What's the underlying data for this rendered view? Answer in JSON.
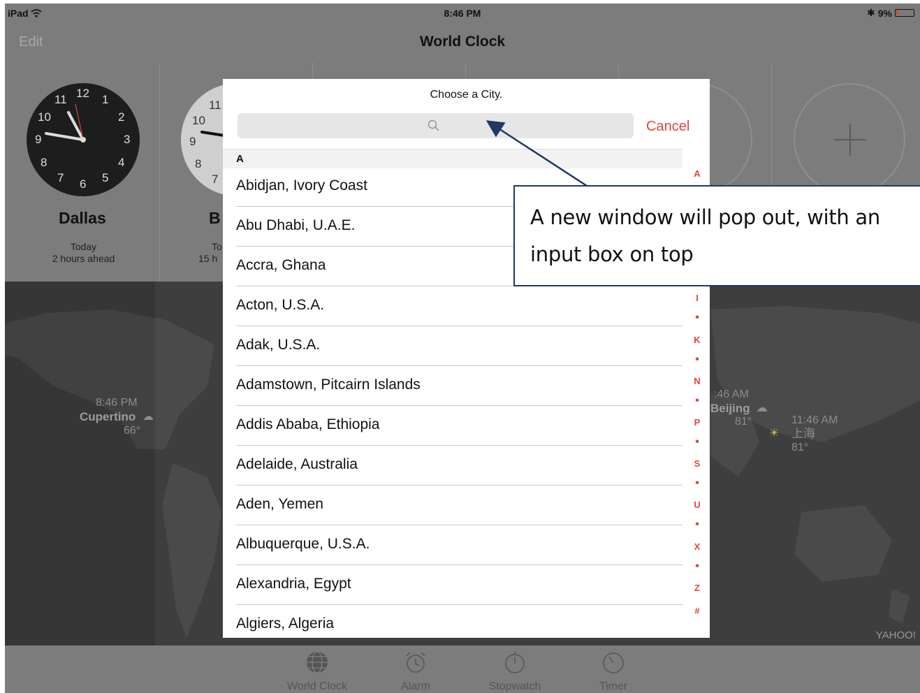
{
  "status_bar": {
    "device": "iPad",
    "time": "8:46 PM",
    "battery": "9%"
  },
  "nav": {
    "edit": "Edit",
    "title": "World Clock"
  },
  "clocks": [
    {
      "name": "Dallas",
      "day": "Today",
      "offset": "2 hours ahead"
    },
    {
      "name": "B",
      "day": "To",
      "offset": "15 h"
    }
  ],
  "clock_numbers": [
    "12",
    "1",
    "2",
    "3",
    "4",
    "5",
    "6",
    "7",
    "8",
    "9",
    "10",
    "11"
  ],
  "map": {
    "cupertino": {
      "time": "8:46 PM",
      "name": "Cupertino",
      "temp": "66°"
    },
    "beijing": {
      "time": ":46 AM",
      "name": "Beijing",
      "temp": "81°"
    },
    "shanghai": {
      "time": "11:46 AM",
      "name": "上海",
      "temp": "81°"
    },
    "credit": "YAHOO!"
  },
  "popover": {
    "title": "Choose a City.",
    "search_placeholder": "",
    "cancel": "Cancel",
    "section": "A",
    "cities": [
      "Abidjan, Ivory Coast",
      "Abu Dhabi, U.A.E.",
      "Accra, Ghana",
      "Acton, U.S.A.",
      "Adak, U.S.A.",
      "Adamstown, Pitcairn Islands",
      "Addis Ababa, Ethiopia",
      "Adelaide, Australia",
      "Aden, Yemen",
      "Albuquerque, U.S.A.",
      "Alexandria, Egypt",
      "Algiers, Algeria"
    ],
    "index": [
      "A",
      "I",
      "•",
      "K",
      "•",
      "N",
      "•",
      "P",
      "•",
      "S",
      "•",
      "U",
      "•",
      "X",
      "•",
      "Z",
      "#"
    ]
  },
  "tabs": [
    "World Clock",
    "Alarm",
    "Stopwatch",
    "Timer"
  ],
  "callout": "A new window will pop out, with an input box on top",
  "colors": {
    "accent": "#e0453a",
    "callout_border": "#1f3864",
    "dim_bar": "#7c7c7c"
  }
}
